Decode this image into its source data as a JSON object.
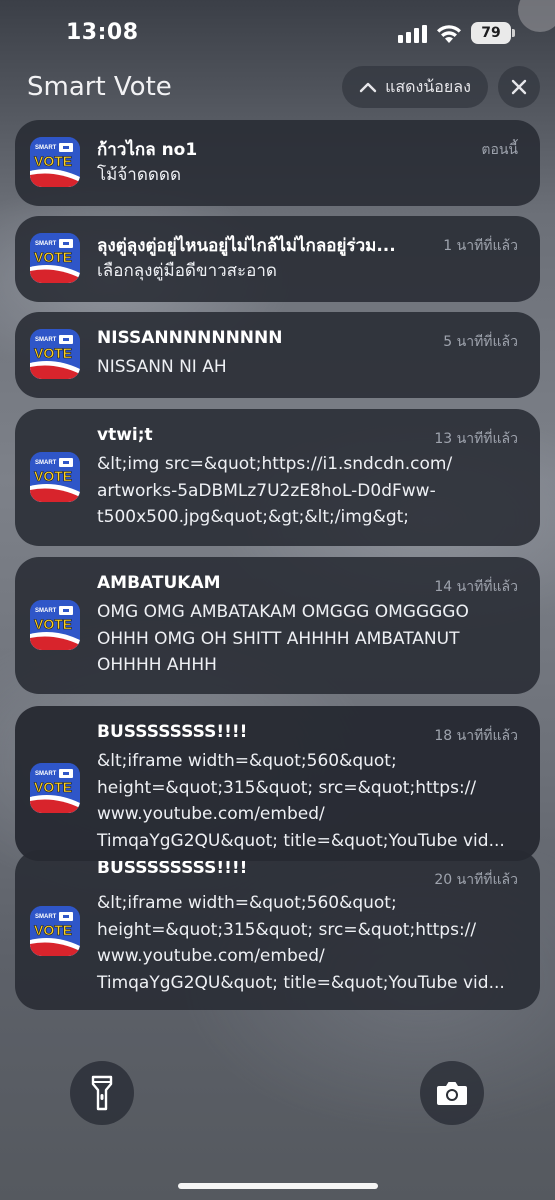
{
  "status_bar": {
    "time": "13:08",
    "battery": "79"
  },
  "header": {
    "app_name": "Smart Vote",
    "show_less_label": "แสดงน้อยลง"
  },
  "app_icon": {
    "top_text": "SMART",
    "main_text": "VOTE",
    "bg_color": "#2f56c8",
    "accent_color": "#d8242c"
  },
  "notifications": [
    {
      "title": "ก้าวไกล no1",
      "time": "ตอนนี้",
      "body": "โม้จ้าดดดด"
    },
    {
      "title": "ลุงตู่ลุงตู่อยู่ไหนอยู่ไม่ไกล้ไม่ไกลอยู่ร่วม...",
      "time": "1 นาทีที่แล้ว",
      "body": "เลือกลุงตู่มือดีขาวสะอาด"
    },
    {
      "title": "NISSANNNNNNNNN",
      "time": "5 นาทีที่แล้ว",
      "body": "NISSANN NI AH"
    },
    {
      "title": "vtwi;t",
      "time": "13 นาทีที่แล้ว",
      "body": "&lt;img src=&quot;https://i1.sndcdn.com/\nartworks-5aDBMLz7U2zE8hoL-D0dFww-\nt500x500.jpg&quot;&gt;&lt;/img&gt;"
    },
    {
      "title": "AMBATUKAM",
      "time": "14 นาทีที่แล้ว",
      "body": "OMG OMG AMBATAKAM OMGGG OMGGGGO\nOHHH OMG OH SHITT AHHHH AMBATANUT\nOHHHH AHHH"
    },
    {
      "title": "BUSSSSSSSS!!!!",
      "time": "18 นาทีที่แล้ว",
      "body": "&lt;iframe width=&quot;560&quot;\nheight=&quot;315&quot; src=&quot;https://\nwww.youtube.com/embed/\nTimqaYgG2QU&quot; title=&quot;YouTube vid..."
    },
    {
      "title": "BUSSSSSSSS!!!!",
      "time": "20 นาทีที่แล้ว",
      "body": "&lt;iframe width=&quot;560&quot;\nheight=&quot;315&quot; src=&quot;https://\nwww.youtube.com/embed/\nTimqaYgG2QU&quot; title=&quot;YouTube vid..."
    }
  ],
  "bottom_controls": {
    "left_icon": "flashlight-icon",
    "right_icon": "camera-icon"
  }
}
